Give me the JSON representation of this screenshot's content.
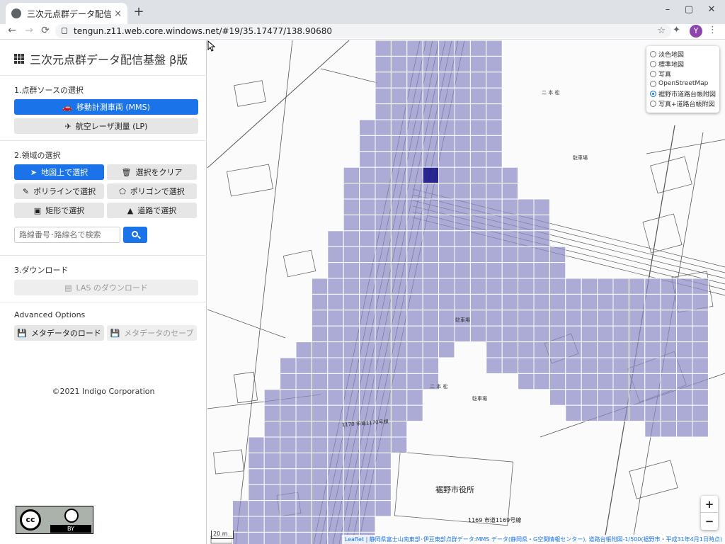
{
  "browser": {
    "tab_title": "三次元点群データ配信基盤 β版",
    "tab_close": "×",
    "new_tab": "+",
    "url": "tengun.z11.web.core.windows.net/#19/35.17477/138.90680",
    "avatar_letter": "Y",
    "nav_back": "←",
    "nav_forward": "→",
    "nav_reload": "⟳",
    "minimize": "–",
    "maximize": "▢",
    "close": "✕",
    "star": "☆",
    "ext": "✦",
    "menu": "⋮"
  },
  "sidebar": {
    "app_title": "三次元点群データ配信基盤 β版",
    "section1_label": "1.点群ソースの選択",
    "mms_button": "移動計測車両 (MMS)",
    "lp_button": "航空レーザ測量 (LP)",
    "section2_label": "2.領域の選択",
    "map_select_button": "地図上で選択",
    "clear_selection_button": "選択をクリア",
    "polyline_select_button": "ポリラインで選択",
    "polygon_select_button": "ポリゴンで選択",
    "rect_select_button": "矩形で選択",
    "road_select_button": "道路で選択",
    "search_placeholder": "路線番号･路線名で検索",
    "section3_label": "3.ダウンロード",
    "las_download_button": "LAS のダウンロード",
    "advanced_label": "Advanced Options",
    "load_metadata_button": "メタデータのロード",
    "save_metadata_button": "メタデータのセーブ",
    "copyright": "©2021 Indigo Corporation",
    "cc_label": "cc",
    "by_label": "BY"
  },
  "icons": {
    "car": "🚗",
    "plane": "✈",
    "pointer": "➤",
    "trash": "🗑",
    "pencil": "✎",
    "polygon": "⬠",
    "rect": "▣",
    "road": "▲",
    "file": "▤",
    "floppy": "💾"
  },
  "map": {
    "layers": [
      {
        "label": "淡色地図",
        "selected": false
      },
      {
        "label": "標準地図",
        "selected": false
      },
      {
        "label": "写真",
        "selected": false
      },
      {
        "label": "OpenStreetMap",
        "selected": false
      },
      {
        "label": "裾野市道路台帳附図",
        "selected": true
      },
      {
        "label": "写真+道路台帳附図",
        "selected": false
      }
    ],
    "zoom_in": "+",
    "zoom_out": "−",
    "scale_label": "20 m",
    "attribution": "Leaflet | 静岡県富士山南東部･伊豆東部点群データ:MMS データ(静岡県・G空間情報センター), 道路台帳附図-1/500(裾野市・平成31年4月1日時点)",
    "labels": {
      "city_hall": "裾野市役所",
      "nihongi_1": "二 本 松",
      "nihongi_2": "二 本 松",
      "parking_1": "駐車場",
      "parking_2": "駐車場",
      "parking_3": "駐車場",
      "route_1169": "1169 市道1169号線",
      "route_1170": "1170 市道1170号線"
    },
    "colors": {
      "tile": "#8c8cc8",
      "tile_selected": "#1c1c8a",
      "accent": "#1a73e8"
    }
  }
}
